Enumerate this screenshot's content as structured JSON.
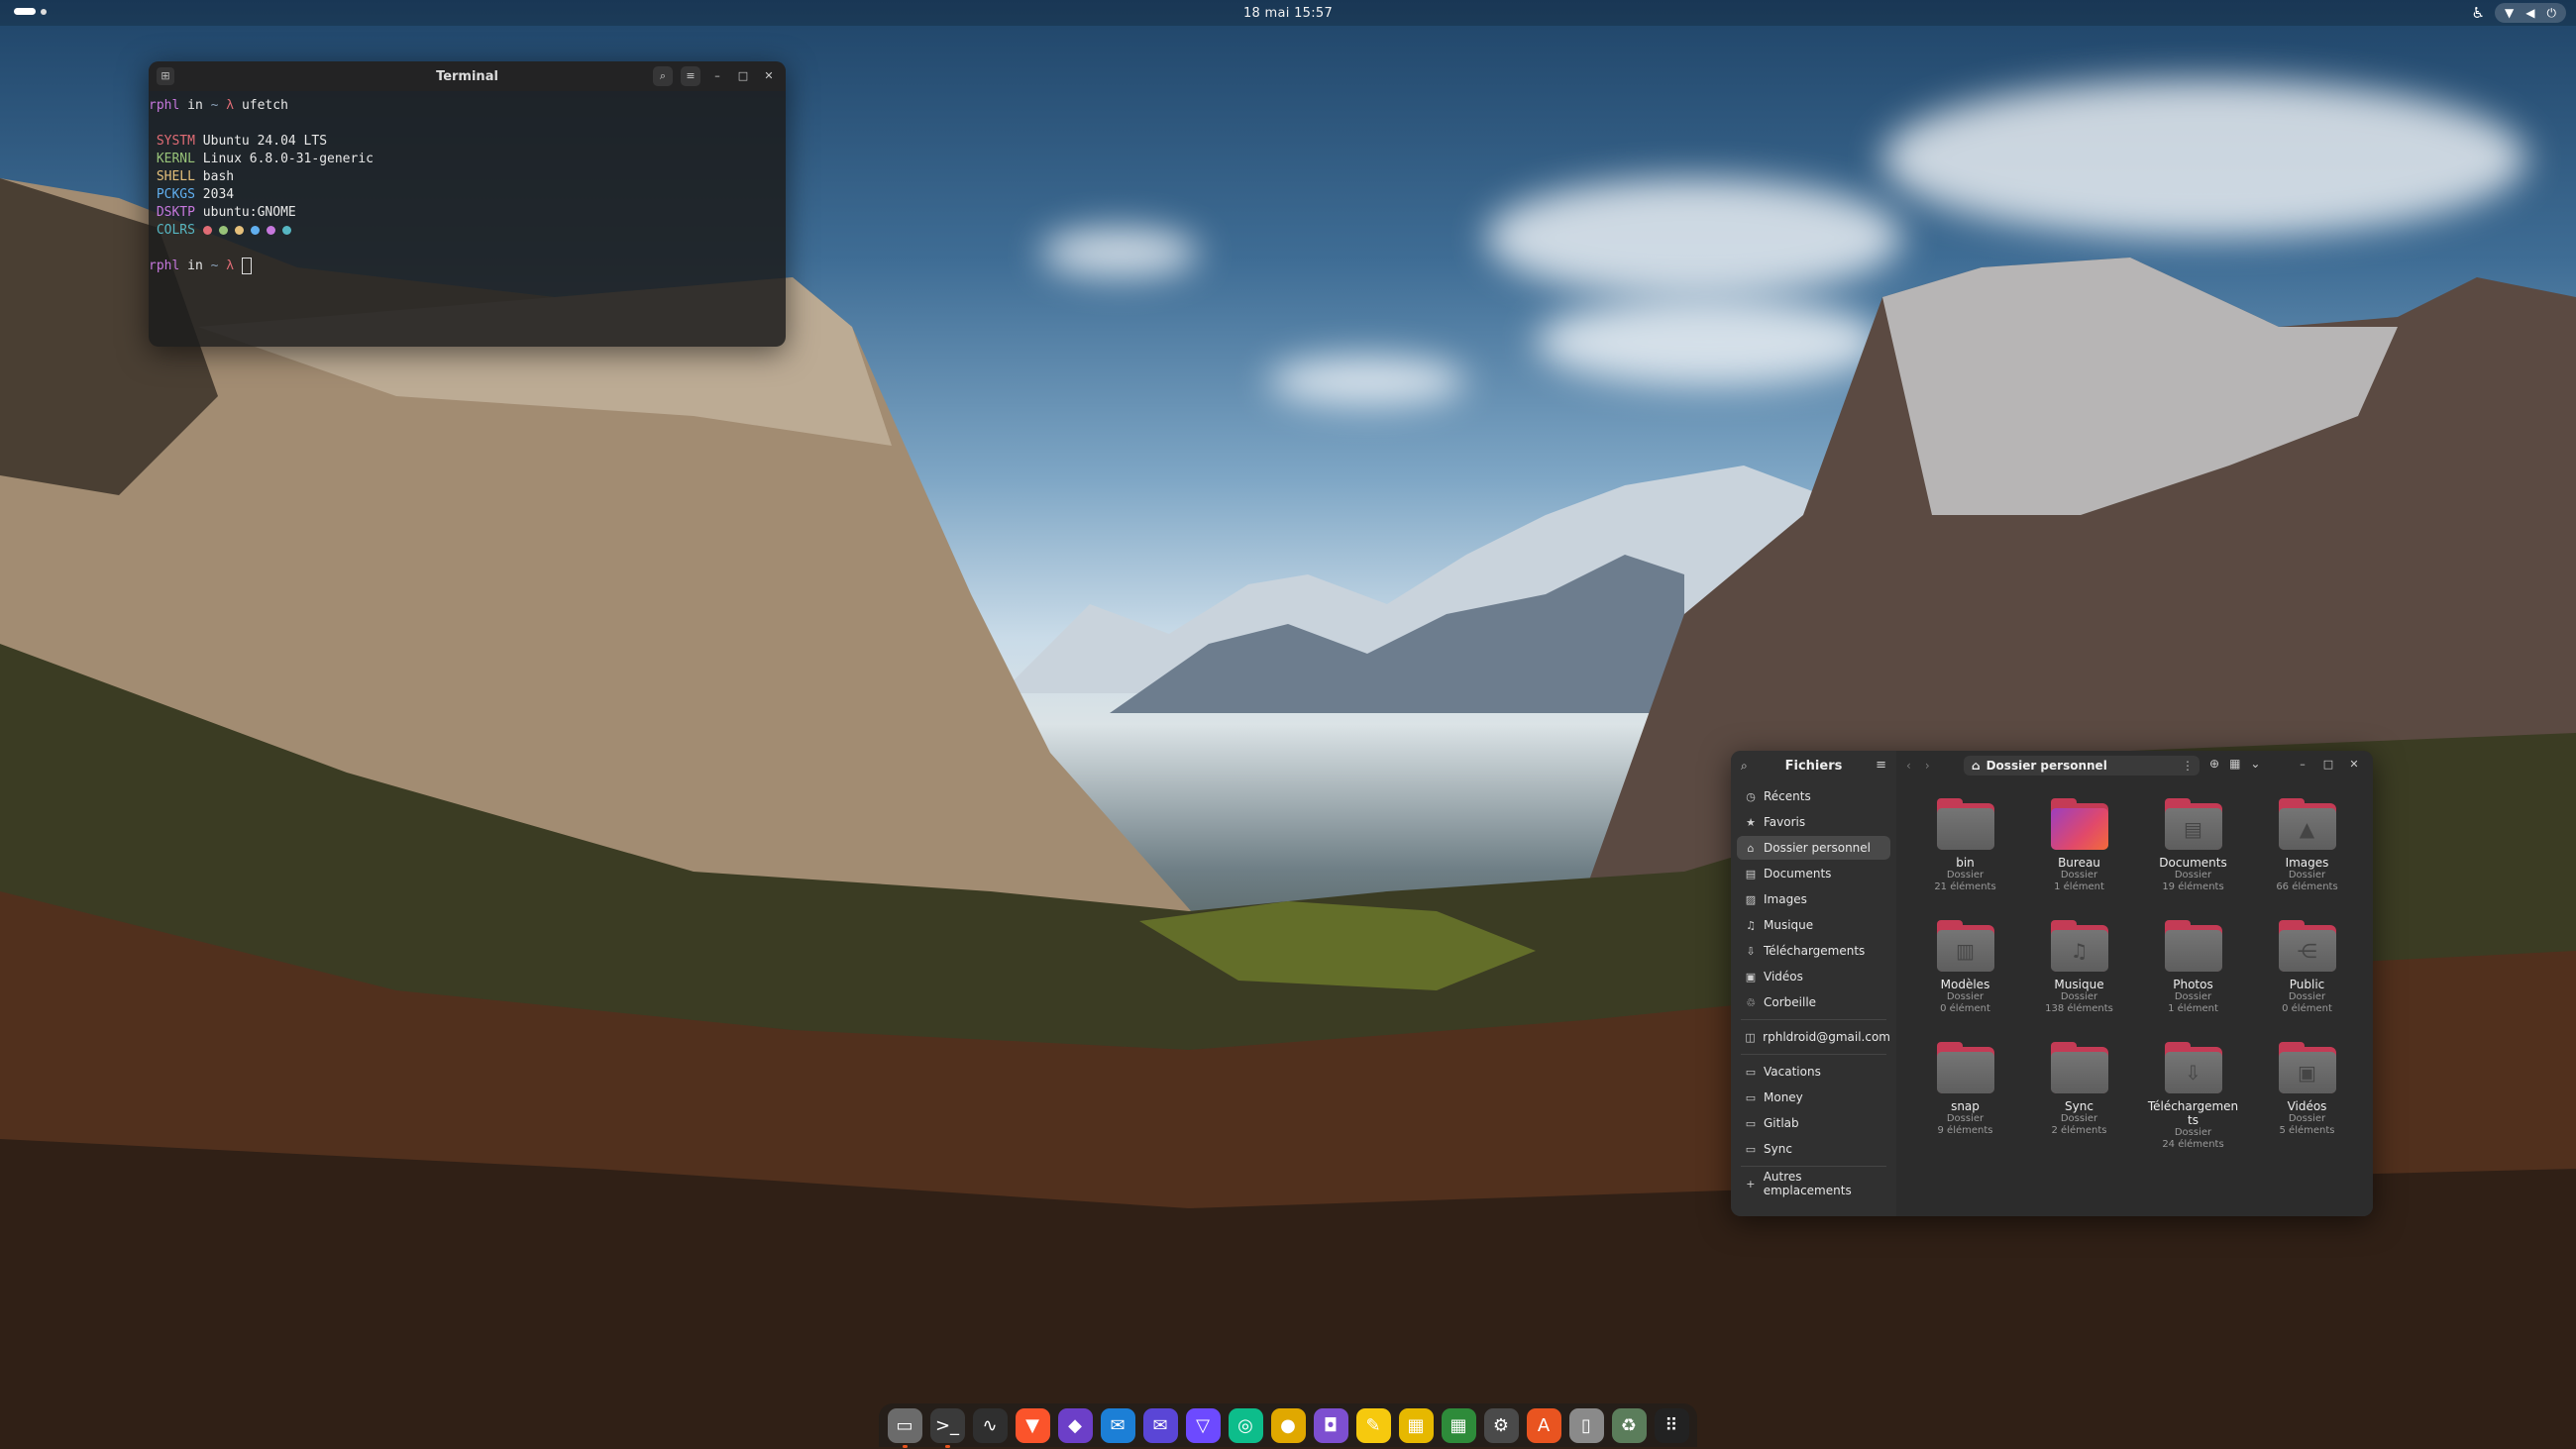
{
  "topbar": {
    "clock": "18 mai  15:57"
  },
  "terminal": {
    "title": "Terminal",
    "prompt1": {
      "user": "rphl",
      "in": " in ",
      "tilde": "~",
      "lambda": " λ ",
      "command": "ufetch"
    },
    "fetch": [
      {
        "key": "SYSTM",
        "value": "Ubuntu 24.04 LTS",
        "color": "#e06c75"
      },
      {
        "key": "KERNL",
        "value": "Linux 6.8.0-31-generic",
        "color": "#98c379"
      },
      {
        "key": "SHELL",
        "value": "bash",
        "color": "#e5c07b"
      },
      {
        "key": "PCKGS",
        "value": "2034",
        "color": "#61afef"
      },
      {
        "key": "DSKTP",
        "value": "ubuntu:GNOME",
        "color": "#c678dd"
      },
      {
        "key": "COLRS",
        "value": "",
        "color": "#56b6c2"
      }
    ],
    "swatches": [
      "#e06c75",
      "#98c379",
      "#e5c07b",
      "#61afef",
      "#c678dd",
      "#56b6c2"
    ],
    "prompt2": {
      "user": "rphl",
      "in": " in ",
      "tilde": "~",
      "lambda": " λ "
    }
  },
  "files": {
    "title": "Fichiers",
    "path": "Dossier personnel",
    "sidebar": [
      {
        "label": "Récents",
        "icon": "clock-icon"
      },
      {
        "label": "Favoris",
        "icon": "star-icon"
      },
      {
        "label": "Dossier personnel",
        "icon": "home-icon",
        "active": true
      },
      {
        "label": "Documents",
        "icon": "document-icon"
      },
      {
        "label": "Images",
        "icon": "image-icon"
      },
      {
        "label": "Musique",
        "icon": "music-icon"
      },
      {
        "label": "Téléchargements",
        "icon": "download-icon"
      },
      {
        "label": "Vidéos",
        "icon": "video-icon"
      },
      {
        "label": "Corbeille",
        "icon": "trash-icon"
      }
    ],
    "account": "rphldroid@gmail.com",
    "bookmarks": [
      "Vacations",
      "Money",
      "Gitlab",
      "Sync"
    ],
    "other": "Autres emplacements",
    "items": [
      {
        "name": "bin",
        "type": "Dossier",
        "count": "21 éléments",
        "glyph": ""
      },
      {
        "name": "Bureau",
        "type": "Dossier",
        "count": "1 élément",
        "glyph": "",
        "desktop": true
      },
      {
        "name": "Documents",
        "type": "Dossier",
        "count": "19 éléments",
        "glyph": "▤"
      },
      {
        "name": "Images",
        "type": "Dossier",
        "count": "66 éléments",
        "glyph": "▲"
      },
      {
        "name": "Modèles",
        "type": "Dossier",
        "count": "0 élément",
        "glyph": "▥"
      },
      {
        "name": "Musique",
        "type": "Dossier",
        "count": "138 éléments",
        "glyph": "♫"
      },
      {
        "name": "Photos",
        "type": "Dossier",
        "count": "1 élément",
        "glyph": ""
      },
      {
        "name": "Public",
        "type": "Dossier",
        "count": "0 élément",
        "glyph": "⋲"
      },
      {
        "name": "snap",
        "type": "Dossier",
        "count": "9 éléments",
        "glyph": ""
      },
      {
        "name": "Sync",
        "type": "Dossier",
        "count": "2 éléments",
        "glyph": ""
      },
      {
        "name": "Téléchargements",
        "type": "Dossier",
        "count": "24 éléments",
        "glyph": "⇩"
      },
      {
        "name": "Vidéos",
        "type": "Dossier",
        "count": "5 éléments",
        "glyph": "▣"
      }
    ]
  },
  "dock": [
    {
      "name": "files-app-icon",
      "bg": "#6b6b6b",
      "glyph": "▭",
      "running": true
    },
    {
      "name": "terminal-app-icon",
      "bg": "#3a3a3a",
      "glyph": ">_",
      "running": true
    },
    {
      "name": "system-monitor-icon",
      "bg": "#2f2f2f",
      "glyph": "∿"
    },
    {
      "name": "brave-browser-icon",
      "bg": "#fb542b",
      "glyph": "▼"
    },
    {
      "name": "obsidian-icon",
      "bg": "#6c3fc8",
      "glyph": "◆"
    },
    {
      "name": "thunderbird-icon",
      "bg": "#1c7fd6",
      "glyph": "✉"
    },
    {
      "name": "mail-app-icon",
      "bg": "#5a46d6",
      "glyph": "✉"
    },
    {
      "name": "proton-vpn-icon",
      "bg": "#6d4aff",
      "glyph": "▽"
    },
    {
      "name": "element-chat-icon",
      "bg": "#0dbd8b",
      "glyph": "◎"
    },
    {
      "name": "ubuntu-pro-icon",
      "bg": "#e0a800",
      "glyph": "●"
    },
    {
      "name": "bitwarden-icon",
      "bg": "#7d4fd0",
      "glyph": "◘"
    },
    {
      "name": "notes-app-icon",
      "bg": "#f6c90e",
      "glyph": "✎"
    },
    {
      "name": "calculator-icon",
      "bg": "#e6b800",
      "glyph": "▦"
    },
    {
      "name": "spreadsheet-icon",
      "bg": "#2e8b3a",
      "glyph": "▦"
    },
    {
      "name": "settings-icon",
      "bg": "#4a4a4a",
      "glyph": "⚙"
    },
    {
      "name": "app-center-icon",
      "bg": "#e95420",
      "glyph": "A"
    },
    {
      "name": "text-editor-icon",
      "bg": "#8a8a8a",
      "glyph": "▯"
    },
    {
      "name": "trash-dock-icon",
      "bg": "#5b7d5b",
      "glyph": "♻"
    },
    {
      "name": "show-apps-icon",
      "bg": "#222222",
      "glyph": "⠿"
    }
  ]
}
